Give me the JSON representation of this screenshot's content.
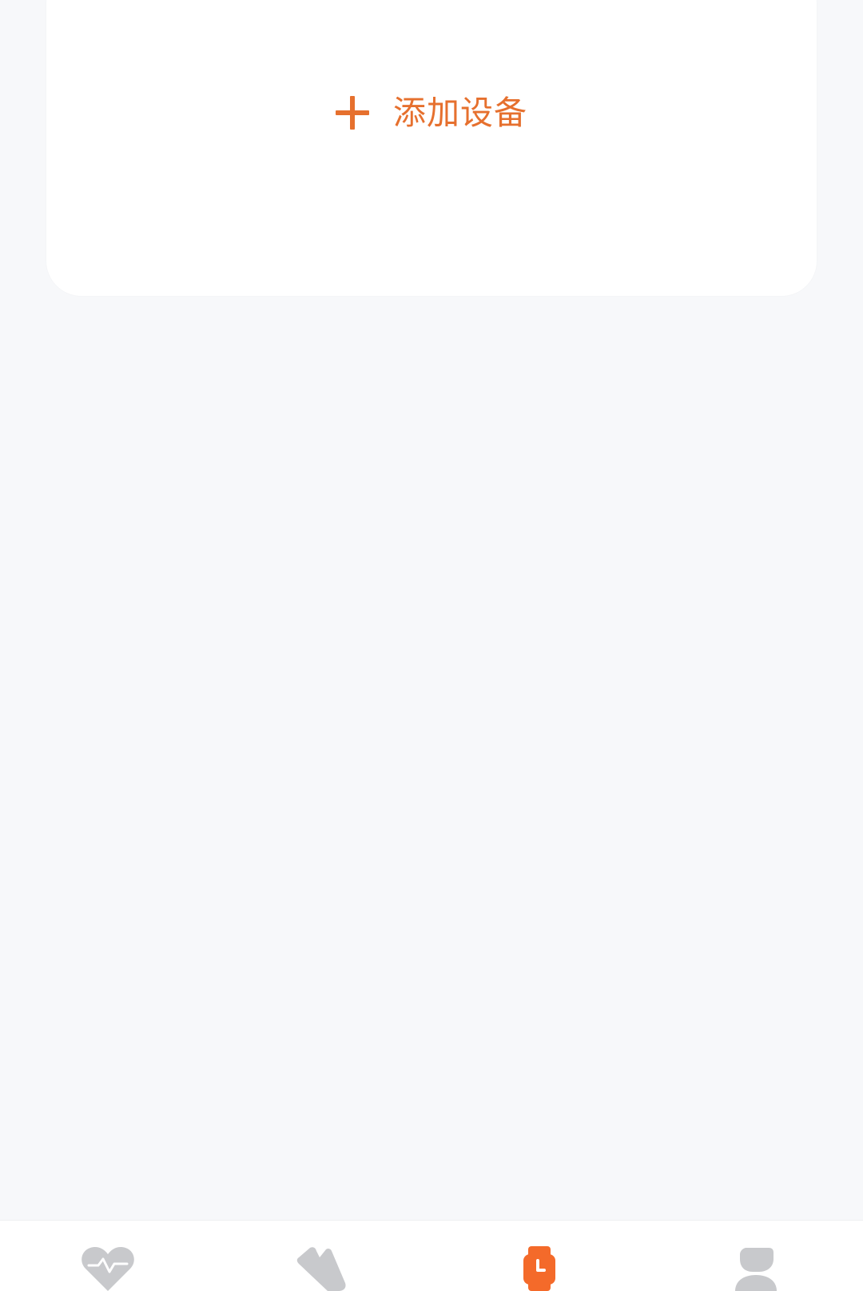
{
  "add_device": {
    "label": "添加设备",
    "icon": "plus-icon"
  },
  "tabbar": {
    "active_tab": "device",
    "tabs": [
      {
        "id": "health",
        "icon": "heart-pulse-icon",
        "active": false
      },
      {
        "id": "exercise",
        "icon": "shoe-icon",
        "active": false
      },
      {
        "id": "device",
        "icon": "watch-icon",
        "active": true
      },
      {
        "id": "profile",
        "icon": "user-icon",
        "active": false
      }
    ]
  },
  "colors": {
    "accent": "#e6702e",
    "active_icon": "#f46a2a",
    "inactive_icon": "#c8c9cc",
    "background": "#f7f8fa",
    "card": "#ffffff"
  }
}
